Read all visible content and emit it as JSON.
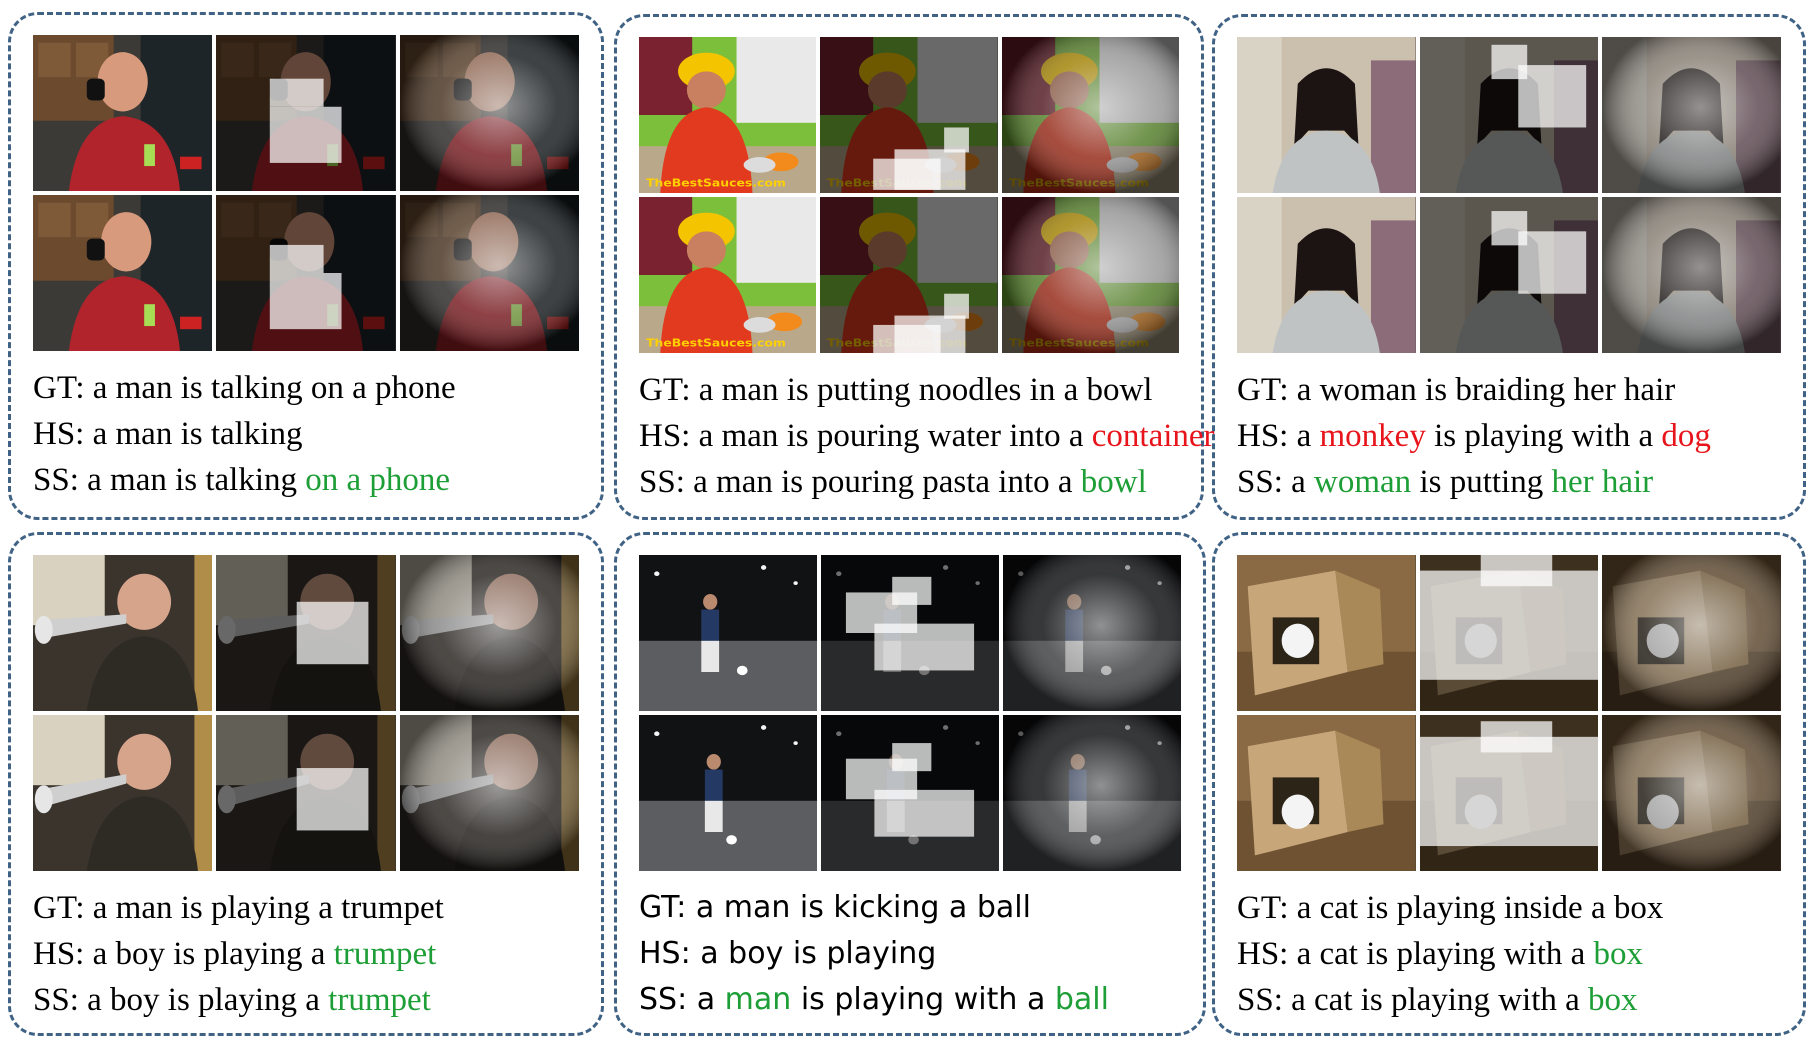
{
  "colors": {
    "border": "#3f6285",
    "red": "#e8141b",
    "green": "#1e9e37"
  },
  "panels": [
    {
      "scene": "office",
      "captions": [
        {
          "segs": [
            {
              "t": "GT: a man is talking on a phone",
              "c": "w"
            }
          ]
        },
        {
          "segs": [
            {
              "t": "HS: a man is talking",
              "c": "w"
            }
          ]
        },
        {
          "segs": [
            {
              "t": "SS: a man is talking ",
              "c": "w"
            },
            {
              "t": "on a phone",
              "c": "green"
            }
          ]
        }
      ],
      "overlays": [
        [
          "none",
          "hard",
          "soft"
        ],
        [
          "none",
          "hard",
          "soft"
        ]
      ]
    },
    {
      "scene": "kitchen",
      "watermark": "TheBestSauces.com",
      "captions": [
        {
          "segs": [
            {
              "t": "GT: a man is putting noodles in a bowl",
              "c": "w"
            }
          ]
        },
        {
          "segs": [
            {
              "t": "HS: a man is pouring water into a ",
              "c": "w"
            },
            {
              "t": "container",
              "c": "red"
            }
          ]
        },
        {
          "segs": [
            {
              "t": "SS: a man is pouring pasta into a ",
              "c": "w"
            },
            {
              "t": "bowl",
              "c": "green"
            }
          ]
        }
      ],
      "overlays": [
        [
          "none",
          "hard",
          "soft"
        ],
        [
          "none",
          "hard",
          "soft"
        ]
      ]
    },
    {
      "scene": "bedroom",
      "captions": [
        {
          "segs": [
            {
              "t": "GT: a woman is braiding her hair",
              "c": "w"
            }
          ]
        },
        {
          "segs": [
            {
              "t": "HS: a ",
              "c": "w"
            },
            {
              "t": "monkey",
              "c": "red"
            },
            {
              "t": " is playing with a ",
              "c": "w"
            },
            {
              "t": "dog",
              "c": "red"
            }
          ]
        },
        {
          "segs": [
            {
              "t": "SS: a ",
              "c": "w"
            },
            {
              "t": "woman",
              "c": "green"
            },
            {
              "t": " is putting ",
              "c": "w"
            },
            {
              "t": "her hair",
              "c": "green"
            }
          ]
        }
      ],
      "overlays": [
        [
          "none",
          "hard",
          "soft"
        ],
        [
          "none",
          "hard",
          "soft"
        ]
      ]
    },
    {
      "scene": "trumpet",
      "captions": [
        {
          "segs": [
            {
              "t": "GT: a man is playing a trumpet",
              "c": "w"
            }
          ]
        },
        {
          "segs": [
            {
              "t": "HS: a boy is playing a ",
              "c": "w"
            },
            {
              "t": "trumpet",
              "c": "green"
            }
          ]
        },
        {
          "segs": [
            {
              "t": "SS: a boy is playing a ",
              "c": "w"
            },
            {
              "t": "trumpet",
              "c": "green"
            }
          ]
        }
      ],
      "overlays": [
        [
          "none",
          "hard",
          "soft"
        ],
        [
          "none",
          "hard",
          "soft"
        ]
      ]
    },
    {
      "scene": "night",
      "captions": [
        {
          "segs": [
            {
              "t": "GT: a man is kicking a ball",
              "c": "w"
            }
          ]
        },
        {
          "segs": [
            {
              "t": "HS: a boy is playing",
              "c": "w"
            }
          ]
        },
        {
          "segs": [
            {
              "t": "SS: a ",
              "c": "w"
            },
            {
              "t": "man",
              "c": "green"
            },
            {
              "t": " is playing with a ",
              "c": "w"
            },
            {
              "t": "ball",
              "c": "green"
            }
          ]
        }
      ],
      "overlays": [
        [
          "none",
          "hard",
          "soft"
        ],
        [
          "none",
          "hard",
          "soft"
        ]
      ]
    },
    {
      "scene": "cat",
      "captions": [
        {
          "segs": [
            {
              "t": "GT: a cat is playing inside a box",
              "c": "w"
            }
          ]
        },
        {
          "segs": [
            {
              "t": "HS: a cat is playing with a ",
              "c": "w"
            },
            {
              "t": "box",
              "c": "green"
            }
          ]
        },
        {
          "segs": [
            {
              "t": "SS: a cat is playing with a ",
              "c": "w"
            },
            {
              "t": "box",
              "c": "green"
            }
          ]
        }
      ],
      "overlays": [
        [
          "none",
          "hard",
          "soft"
        ],
        [
          "none",
          "hard",
          "soft"
        ]
      ]
    }
  ]
}
